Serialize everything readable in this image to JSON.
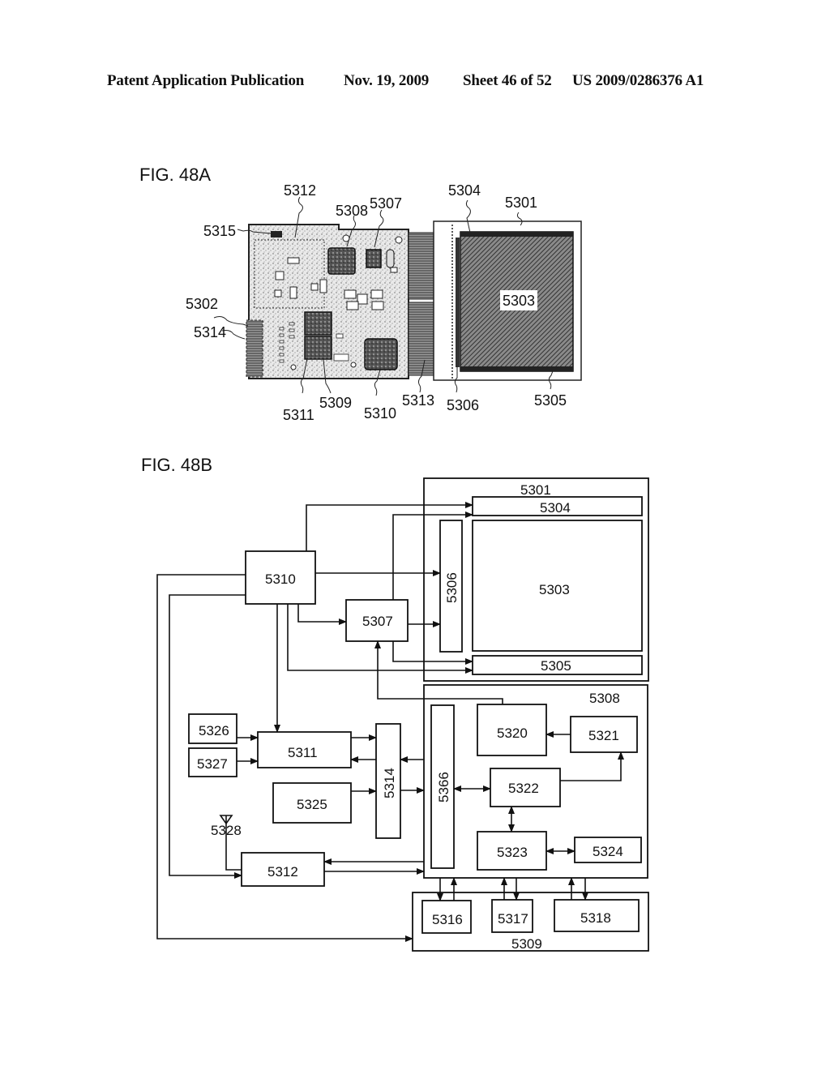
{
  "header": {
    "publication": "Patent Application Publication",
    "date": "Nov. 19, 2009",
    "sheet": "Sheet 46 of 52",
    "number": "US 2009/0286376 A1"
  },
  "fig_a": {
    "title": "FIG. 48A",
    "callouts": {
      "c5312": "5312",
      "c5308": "5308",
      "c5307": "5307",
      "c5304": "5304",
      "c5301": "5301",
      "c5315": "5315",
      "c5302": "5302",
      "c5314": "5314",
      "c5303": "5303",
      "c5311": "5311",
      "c5309": "5309",
      "c5310": "5310",
      "c5313": "5313",
      "c5306": "5306",
      "c5305": "5305"
    }
  },
  "fig_b": {
    "title": "FIG. 48B",
    "blocks": {
      "b5301": "5301",
      "b5304": "5304",
      "b5306": "5306",
      "b5303": "5303",
      "b5305": "5305",
      "b5310": "5310",
      "b5307": "5307",
      "b5308": "5308",
      "b5320": "5320",
      "b5321": "5321",
      "b5366": "5366",
      "b5322": "5322",
      "b5323": "5323",
      "b5324": "5324",
      "b5326": "5326",
      "b5327": "5327",
      "b5311": "5311",
      "b5314": "5314",
      "b5325": "5325",
      "b5328": "5328",
      "b5312": "5312",
      "b5309": "5309",
      "b5316": "5316",
      "b5317": "5317",
      "b5318": "5318"
    }
  }
}
